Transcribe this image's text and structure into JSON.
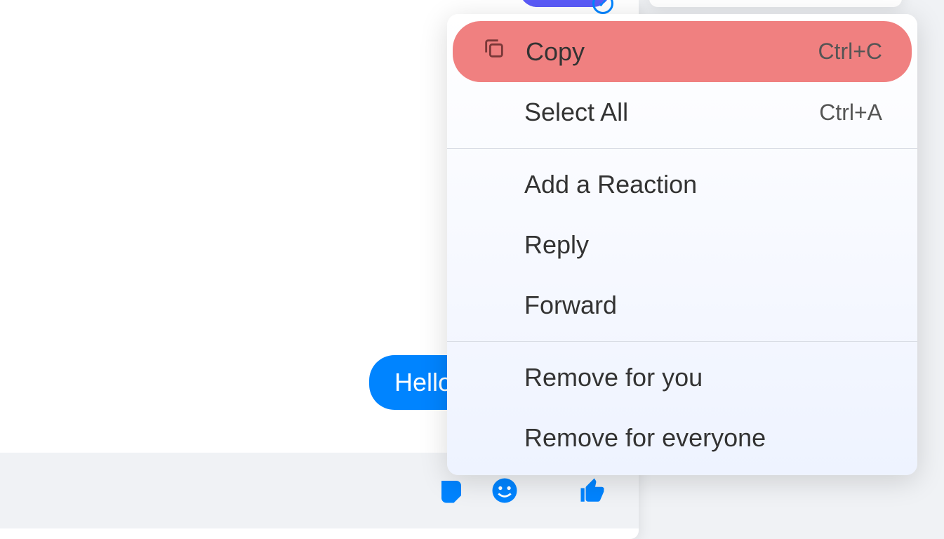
{
  "chat": {
    "message": "Hello",
    "icons": {
      "sticker": "sticker-icon",
      "emoji": "emoji-icon",
      "thumb": "thumb-up-icon"
    }
  },
  "contextMenu": {
    "items": [
      {
        "label": "Copy",
        "shortcut": "Ctrl+C",
        "icon": "copy-icon",
        "highlighted": true
      },
      {
        "label": "Select All",
        "shortcut": "Ctrl+A",
        "icon": null,
        "highlighted": false
      }
    ],
    "group2": [
      {
        "label": "Add a Reaction"
      },
      {
        "label": "Reply"
      },
      {
        "label": "Forward"
      }
    ],
    "group3": [
      {
        "label": "Remove for you"
      },
      {
        "label": "Remove for everyone"
      }
    ]
  }
}
